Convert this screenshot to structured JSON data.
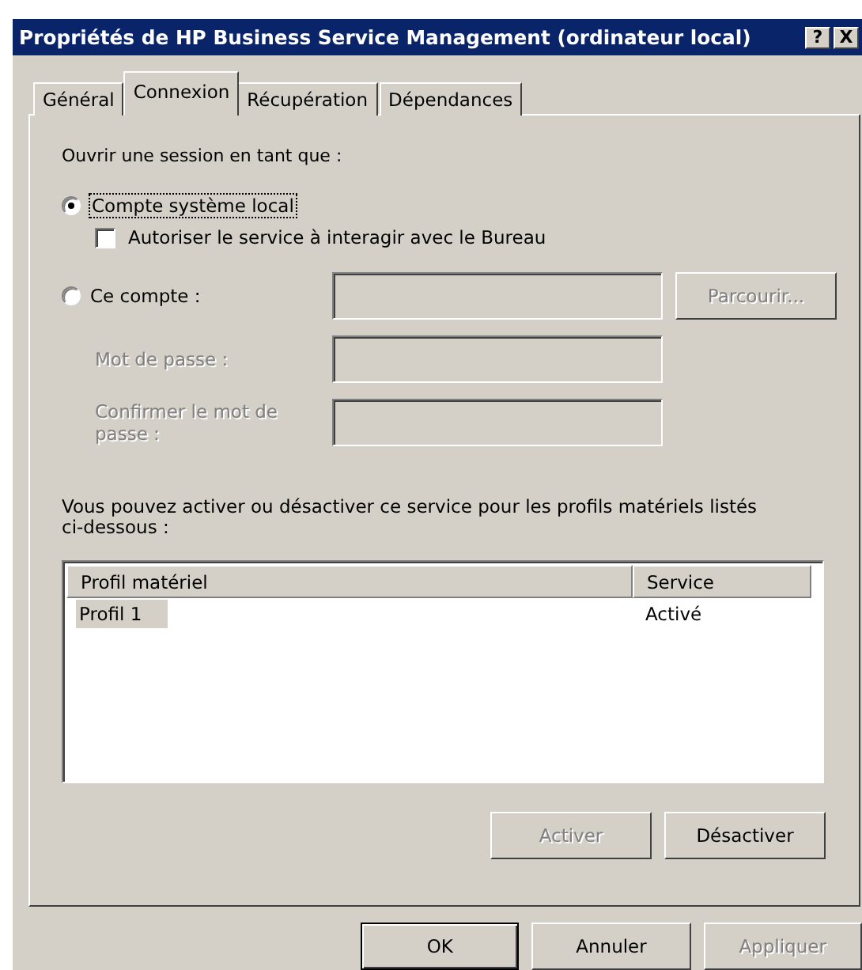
{
  "window": {
    "title": "Propriétés de HP Business Service Management (ordinateur local)",
    "title_buttons": [
      "?",
      "X"
    ]
  },
  "tabs": [
    {
      "label": "Général",
      "selected": false
    },
    {
      "label": "Connexion",
      "selected": true
    },
    {
      "label": "Récupération",
      "selected": false
    },
    {
      "label": "Dépendances",
      "selected": false
    }
  ],
  "logon": {
    "heading": "Ouvrir une session en tant que :",
    "local_account": {
      "label": "Compte système local",
      "selected": true
    },
    "interact_desktop": {
      "label": "Autoriser le service à interagir avec le Bureau",
      "checked": false
    },
    "this_account": {
      "label": "Ce compte :",
      "selected": false
    },
    "browse_button": {
      "label": "Parcourir...",
      "disabled": true
    },
    "password": {
      "label": "Mot de passe :",
      "disabled": true
    },
    "confirm_password": {
      "label": "Confirmer le mot de passe :",
      "disabled": true
    }
  },
  "profiles": {
    "description": "Vous pouvez activer ou désactiver ce service pour les profils matériels listés ci-dessous :",
    "columns": [
      "Profil matériel",
      "Service"
    ],
    "rows": [
      {
        "cells": [
          "Profil 1",
          "Activé"
        ],
        "selected": true
      }
    ],
    "buttons": [
      {
        "label": "Activer",
        "disabled": true
      },
      {
        "label": "Désactiver",
        "disabled": false
      }
    ]
  },
  "footer_buttons": [
    {
      "label": "OK",
      "default": true,
      "disabled": false
    },
    {
      "label": "Annuler",
      "default": false,
      "disabled": false
    },
    {
      "label": "Appliquer",
      "default": false,
      "disabled": true
    }
  ]
}
